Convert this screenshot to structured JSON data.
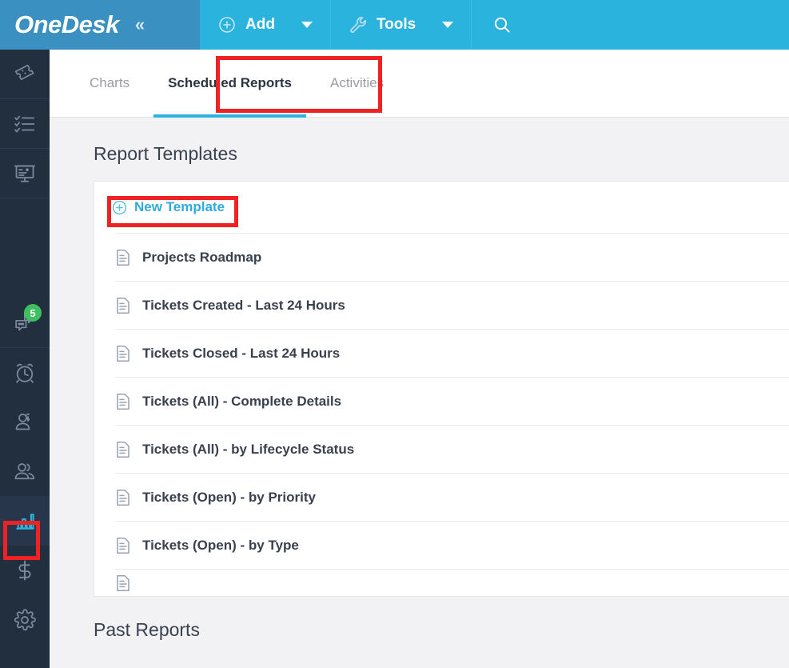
{
  "app": {
    "brand": "OneDesk",
    "collapse_icon": "double-chevron-left-icon"
  },
  "topbar": {
    "add": {
      "label": "Add",
      "icon": "plus-circle-icon",
      "caret": "chevron-down-icon"
    },
    "tools": {
      "label": "Tools",
      "icon": "wrench-icon",
      "caret": "chevron-down-icon"
    },
    "search": {
      "icon": "search-icon"
    }
  },
  "sidebar": {
    "items": [
      {
        "name": "tickets",
        "icon": "ticket-icon",
        "badge": ""
      },
      {
        "name": "tasks",
        "icon": "checklist-icon",
        "badge": ""
      },
      {
        "name": "projects",
        "icon": "presentation-icon",
        "badge": ""
      },
      {
        "name": "messages",
        "icon": "chat-bubbles-icon",
        "badge": "5"
      },
      {
        "name": "timesheets",
        "icon": "alarm-clock-icon",
        "badge": ""
      },
      {
        "name": "customers",
        "icon": "user-dollar-icon",
        "badge": ""
      },
      {
        "name": "users",
        "icon": "users-icon",
        "badge": ""
      },
      {
        "name": "analytics",
        "icon": "bar-chart-icon",
        "badge": ""
      },
      {
        "name": "billing",
        "icon": "dollar-sign-icon",
        "badge": ""
      },
      {
        "name": "settings",
        "icon": "gear-icon",
        "badge": ""
      }
    ],
    "active": "analytics"
  },
  "tabs": [
    {
      "label": "Charts",
      "active": false
    },
    {
      "label": "Scheduled Reports",
      "active": true
    },
    {
      "label": "Activities",
      "active": false
    }
  ],
  "main": {
    "report_templates_title": "Report Templates",
    "new_template_label": "New Template",
    "templates": [
      {
        "label": "Projects Roadmap",
        "icon": "document-icon"
      },
      {
        "label": "Tickets Created - Last 24 Hours",
        "icon": "document-icon"
      },
      {
        "label": "Tickets Closed - Last 24 Hours",
        "icon": "document-icon"
      },
      {
        "label": "Tickets (All) - Complete Details",
        "icon": "document-icon"
      },
      {
        "label": "Tickets (All) - by Lifecycle Status",
        "icon": "document-icon"
      },
      {
        "label": "Tickets (Open) - by Priority",
        "icon": "document-icon"
      },
      {
        "label": "Tickets (Open) - by Type",
        "icon": "document-icon"
      }
    ],
    "past_reports_title": "Past Reports"
  },
  "annotations": {
    "color": "#ee2222",
    "boxes": [
      {
        "target": "tab-scheduled-reports"
      },
      {
        "target": "new-template-button"
      },
      {
        "target": "sidebar-item-analytics"
      }
    ]
  },
  "colors": {
    "brand_blue": "#29b3dd",
    "logo_blue": "#3a90c0",
    "sidebar_dark": "#222f3e",
    "accent_link": "#31aadc",
    "badge_green": "#3fbf5f",
    "annotation_red": "#ee2222",
    "page_bg": "#f2f2f4"
  }
}
